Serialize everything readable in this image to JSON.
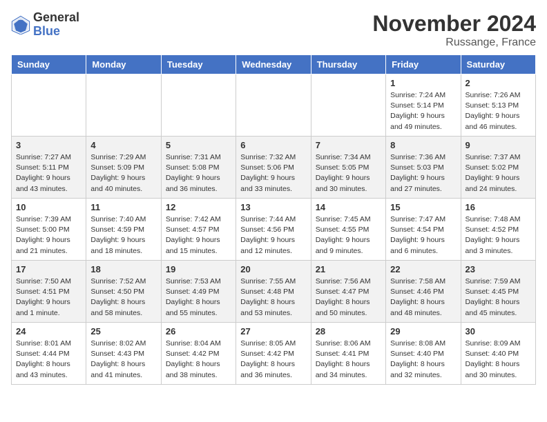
{
  "logo": {
    "general": "General",
    "blue": "Blue"
  },
  "header": {
    "month": "November 2024",
    "location": "Russange, France"
  },
  "weekdays": [
    "Sunday",
    "Monday",
    "Tuesday",
    "Wednesday",
    "Thursday",
    "Friday",
    "Saturday"
  ],
  "weeks": [
    [
      {
        "day": "",
        "info": ""
      },
      {
        "day": "",
        "info": ""
      },
      {
        "day": "",
        "info": ""
      },
      {
        "day": "",
        "info": ""
      },
      {
        "day": "",
        "info": ""
      },
      {
        "day": "1",
        "info": "Sunrise: 7:24 AM\nSunset: 5:14 PM\nDaylight: 9 hours\nand 49 minutes."
      },
      {
        "day": "2",
        "info": "Sunrise: 7:26 AM\nSunset: 5:13 PM\nDaylight: 9 hours\nand 46 minutes."
      }
    ],
    [
      {
        "day": "3",
        "info": "Sunrise: 7:27 AM\nSunset: 5:11 PM\nDaylight: 9 hours\nand 43 minutes."
      },
      {
        "day": "4",
        "info": "Sunrise: 7:29 AM\nSunset: 5:09 PM\nDaylight: 9 hours\nand 40 minutes."
      },
      {
        "day": "5",
        "info": "Sunrise: 7:31 AM\nSunset: 5:08 PM\nDaylight: 9 hours\nand 36 minutes."
      },
      {
        "day": "6",
        "info": "Sunrise: 7:32 AM\nSunset: 5:06 PM\nDaylight: 9 hours\nand 33 minutes."
      },
      {
        "day": "7",
        "info": "Sunrise: 7:34 AM\nSunset: 5:05 PM\nDaylight: 9 hours\nand 30 minutes."
      },
      {
        "day": "8",
        "info": "Sunrise: 7:36 AM\nSunset: 5:03 PM\nDaylight: 9 hours\nand 27 minutes."
      },
      {
        "day": "9",
        "info": "Sunrise: 7:37 AM\nSunset: 5:02 PM\nDaylight: 9 hours\nand 24 minutes."
      }
    ],
    [
      {
        "day": "10",
        "info": "Sunrise: 7:39 AM\nSunset: 5:00 PM\nDaylight: 9 hours\nand 21 minutes."
      },
      {
        "day": "11",
        "info": "Sunrise: 7:40 AM\nSunset: 4:59 PM\nDaylight: 9 hours\nand 18 minutes."
      },
      {
        "day": "12",
        "info": "Sunrise: 7:42 AM\nSunset: 4:57 PM\nDaylight: 9 hours\nand 15 minutes."
      },
      {
        "day": "13",
        "info": "Sunrise: 7:44 AM\nSunset: 4:56 PM\nDaylight: 9 hours\nand 12 minutes."
      },
      {
        "day": "14",
        "info": "Sunrise: 7:45 AM\nSunset: 4:55 PM\nDaylight: 9 hours\nand 9 minutes."
      },
      {
        "day": "15",
        "info": "Sunrise: 7:47 AM\nSunset: 4:54 PM\nDaylight: 9 hours\nand 6 minutes."
      },
      {
        "day": "16",
        "info": "Sunrise: 7:48 AM\nSunset: 4:52 PM\nDaylight: 9 hours\nand 3 minutes."
      }
    ],
    [
      {
        "day": "17",
        "info": "Sunrise: 7:50 AM\nSunset: 4:51 PM\nDaylight: 9 hours\nand 1 minute."
      },
      {
        "day": "18",
        "info": "Sunrise: 7:52 AM\nSunset: 4:50 PM\nDaylight: 8 hours\nand 58 minutes."
      },
      {
        "day": "19",
        "info": "Sunrise: 7:53 AM\nSunset: 4:49 PM\nDaylight: 8 hours\nand 55 minutes."
      },
      {
        "day": "20",
        "info": "Sunrise: 7:55 AM\nSunset: 4:48 PM\nDaylight: 8 hours\nand 53 minutes."
      },
      {
        "day": "21",
        "info": "Sunrise: 7:56 AM\nSunset: 4:47 PM\nDaylight: 8 hours\nand 50 minutes."
      },
      {
        "day": "22",
        "info": "Sunrise: 7:58 AM\nSunset: 4:46 PM\nDaylight: 8 hours\nand 48 minutes."
      },
      {
        "day": "23",
        "info": "Sunrise: 7:59 AM\nSunset: 4:45 PM\nDaylight: 8 hours\nand 45 minutes."
      }
    ],
    [
      {
        "day": "24",
        "info": "Sunrise: 8:01 AM\nSunset: 4:44 PM\nDaylight: 8 hours\nand 43 minutes."
      },
      {
        "day": "25",
        "info": "Sunrise: 8:02 AM\nSunset: 4:43 PM\nDaylight: 8 hours\nand 41 minutes."
      },
      {
        "day": "26",
        "info": "Sunrise: 8:04 AM\nSunset: 4:42 PM\nDaylight: 8 hours\nand 38 minutes."
      },
      {
        "day": "27",
        "info": "Sunrise: 8:05 AM\nSunset: 4:42 PM\nDaylight: 8 hours\nand 36 minutes."
      },
      {
        "day": "28",
        "info": "Sunrise: 8:06 AM\nSunset: 4:41 PM\nDaylight: 8 hours\nand 34 minutes."
      },
      {
        "day": "29",
        "info": "Sunrise: 8:08 AM\nSunset: 4:40 PM\nDaylight: 8 hours\nand 32 minutes."
      },
      {
        "day": "30",
        "info": "Sunrise: 8:09 AM\nSunset: 4:40 PM\nDaylight: 8 hours\nand 30 minutes."
      }
    ]
  ]
}
